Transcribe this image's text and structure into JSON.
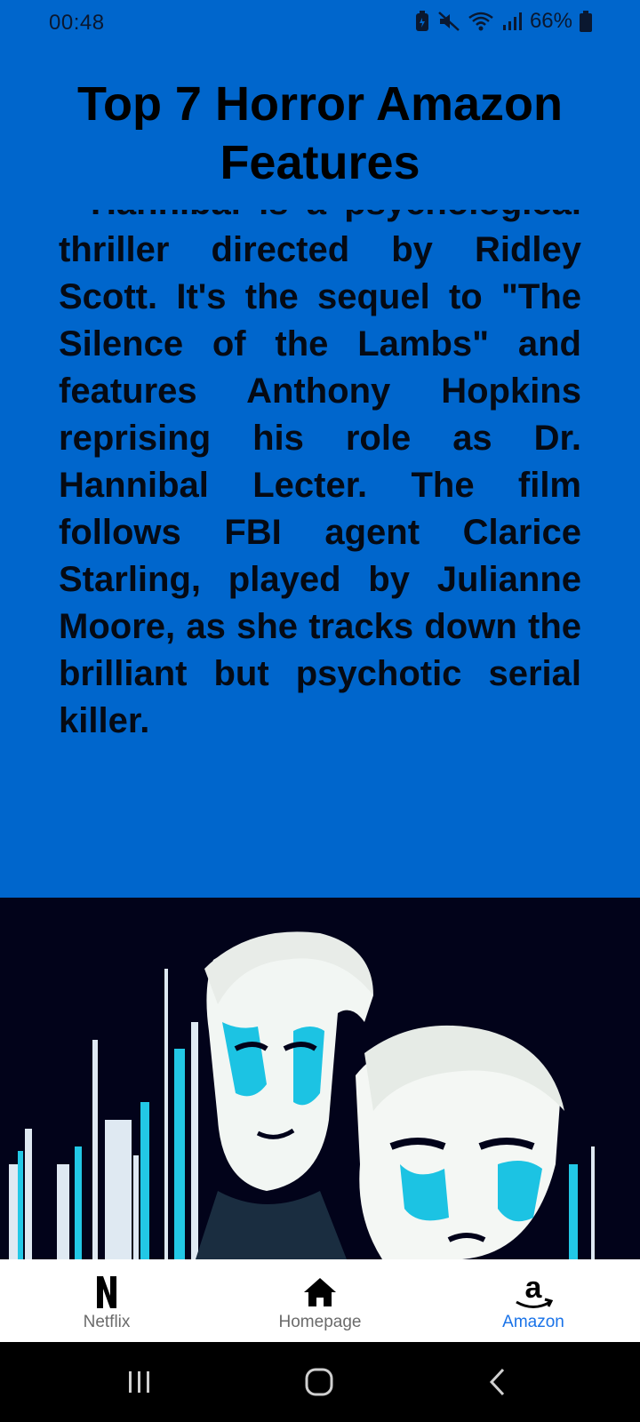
{
  "status_bar": {
    "time": "00:48",
    "battery": "66%",
    "icons": [
      "battery-saver-icon",
      "mute-icon",
      "wifi-icon",
      "signal-icon",
      "battery-icon"
    ]
  },
  "page": {
    "title": "Top 7 Horror Amazon Features",
    "description": "Hannibal is a psychological thriller directed by Ridley Scott. It's the sequel to \"The Silence of the Lambs\" and features Anthony Hopkins reprising his role as Dr. Hannibal Lecter. The film follows FBI agent Clarice Starling, played by Julianne Moore, as she tracks down the brilliant but psychotic serial killer."
  },
  "poster": {
    "icon": "movie-poster-image"
  },
  "bottom_nav": {
    "items": [
      {
        "label": "Netflix",
        "icon": "netflix-icon",
        "active": false
      },
      {
        "label": "Homepage",
        "icon": "home-icon",
        "active": false
      },
      {
        "label": "Amazon",
        "icon": "amazon-icon",
        "active": true
      }
    ]
  },
  "colors": {
    "background": "#0066cc",
    "poster_bg": "#02031a",
    "accent": "#1a73e8"
  }
}
